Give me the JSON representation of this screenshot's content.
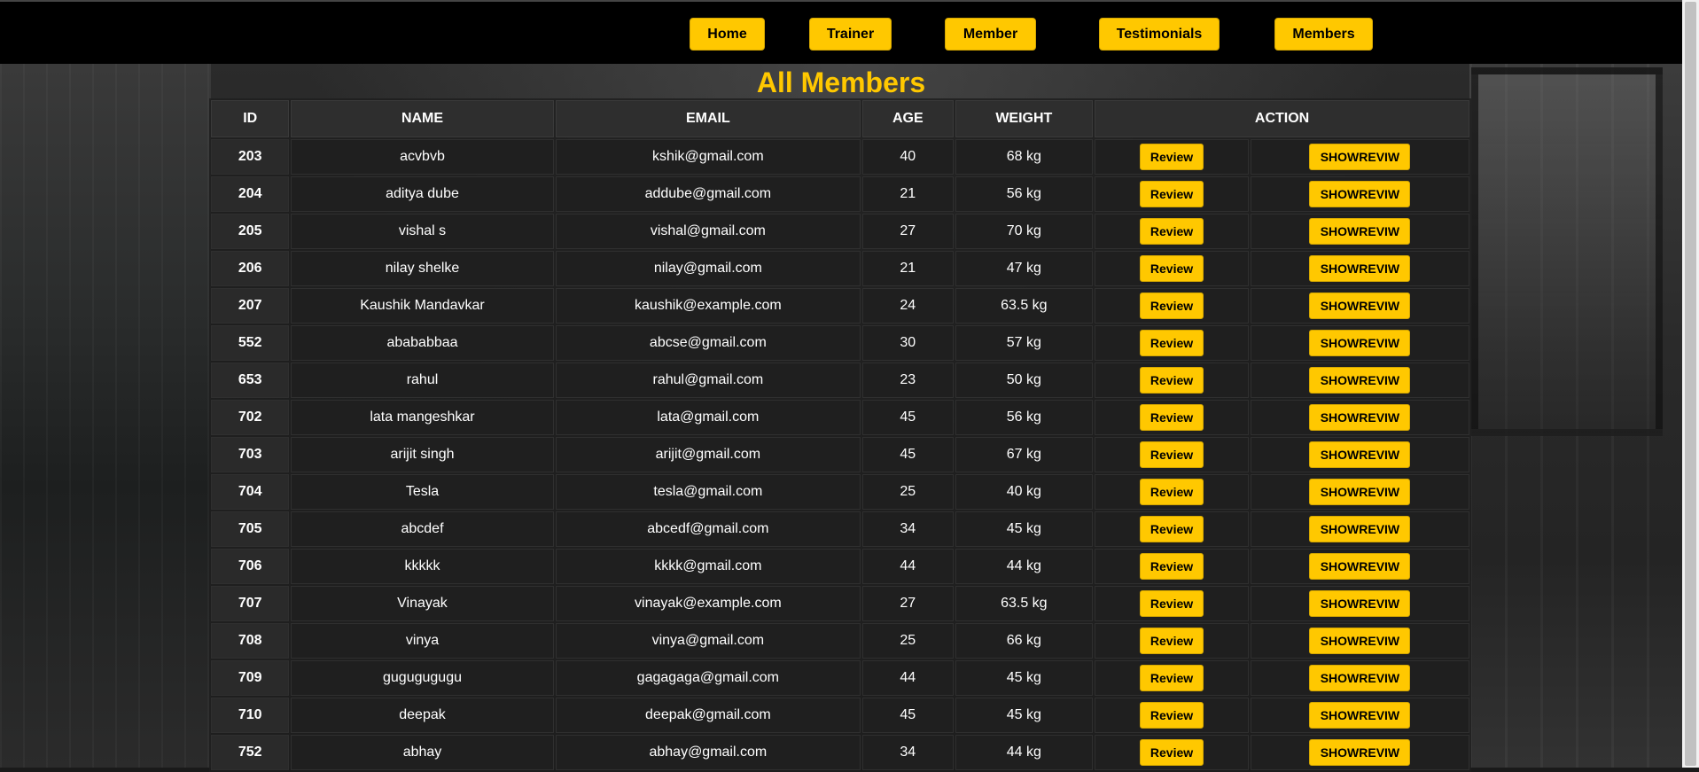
{
  "nav": {
    "home": "Home",
    "trainer": "Trainer",
    "member": "Member",
    "testimonials": "Testimonials",
    "members": "Members"
  },
  "page": {
    "title": "All Members"
  },
  "table": {
    "headers": {
      "id": "ID",
      "name": "NAME",
      "email": "EMAIL",
      "age": "AGE",
      "weight": "WEIGHT",
      "action": "ACTION"
    },
    "review_label": "Review",
    "showreview_label": "SHOWREVIW",
    "rows": [
      {
        "id": "203",
        "name": "acvbvb",
        "email": "kshik@gmail.com",
        "age": "40",
        "weight": "68 kg"
      },
      {
        "id": "204",
        "name": "aditya dube",
        "email": "addube@gmail.com",
        "age": "21",
        "weight": "56 kg"
      },
      {
        "id": "205",
        "name": "vishal s",
        "email": "vishal@gmail.com",
        "age": "27",
        "weight": "70 kg"
      },
      {
        "id": "206",
        "name": "nilay shelke",
        "email": "nilay@gmail.com",
        "age": "21",
        "weight": "47 kg"
      },
      {
        "id": "207",
        "name": "Kaushik Mandavkar",
        "email": "kaushik@example.com",
        "age": "24",
        "weight": "63.5 kg"
      },
      {
        "id": "552",
        "name": "abababbaa",
        "email": "abcse@gmail.com",
        "age": "30",
        "weight": "57 kg"
      },
      {
        "id": "653",
        "name": "rahul",
        "email": "rahul@gmail.com",
        "age": "23",
        "weight": "50 kg"
      },
      {
        "id": "702",
        "name": "lata mangeshkar",
        "email": "lata@gmail.com",
        "age": "45",
        "weight": "56 kg"
      },
      {
        "id": "703",
        "name": "arijit singh",
        "email": "arijit@gmail.com",
        "age": "45",
        "weight": "67 kg"
      },
      {
        "id": "704",
        "name": "Tesla",
        "email": "tesla@gmail.com",
        "age": "25",
        "weight": "40 kg"
      },
      {
        "id": "705",
        "name": "abcdef",
        "email": "abcedf@gmail.com",
        "age": "34",
        "weight": "45 kg"
      },
      {
        "id": "706",
        "name": "kkkkk",
        "email": "kkkk@gmail.com",
        "age": "44",
        "weight": "44 kg"
      },
      {
        "id": "707",
        "name": "Vinayak",
        "email": "vinayak@example.com",
        "age": "27",
        "weight": "63.5 kg"
      },
      {
        "id": "708",
        "name": "vinya",
        "email": "vinya@gmail.com",
        "age": "25",
        "weight": "66 kg"
      },
      {
        "id": "709",
        "name": "gugugugugu",
        "email": "gagagaga@gmail.com",
        "age": "44",
        "weight": "45 kg"
      },
      {
        "id": "710",
        "name": "deepak",
        "email": "deepak@gmail.com",
        "age": "45",
        "weight": "45 kg"
      },
      {
        "id": "752",
        "name": "abhay",
        "email": "abhay@gmail.com",
        "age": "34",
        "weight": "44 kg"
      }
    ]
  },
  "colors": {
    "accent": "#ffc800",
    "topbar": "#000000",
    "cell": "#1f1f1f",
    "text": "#ffffff"
  }
}
